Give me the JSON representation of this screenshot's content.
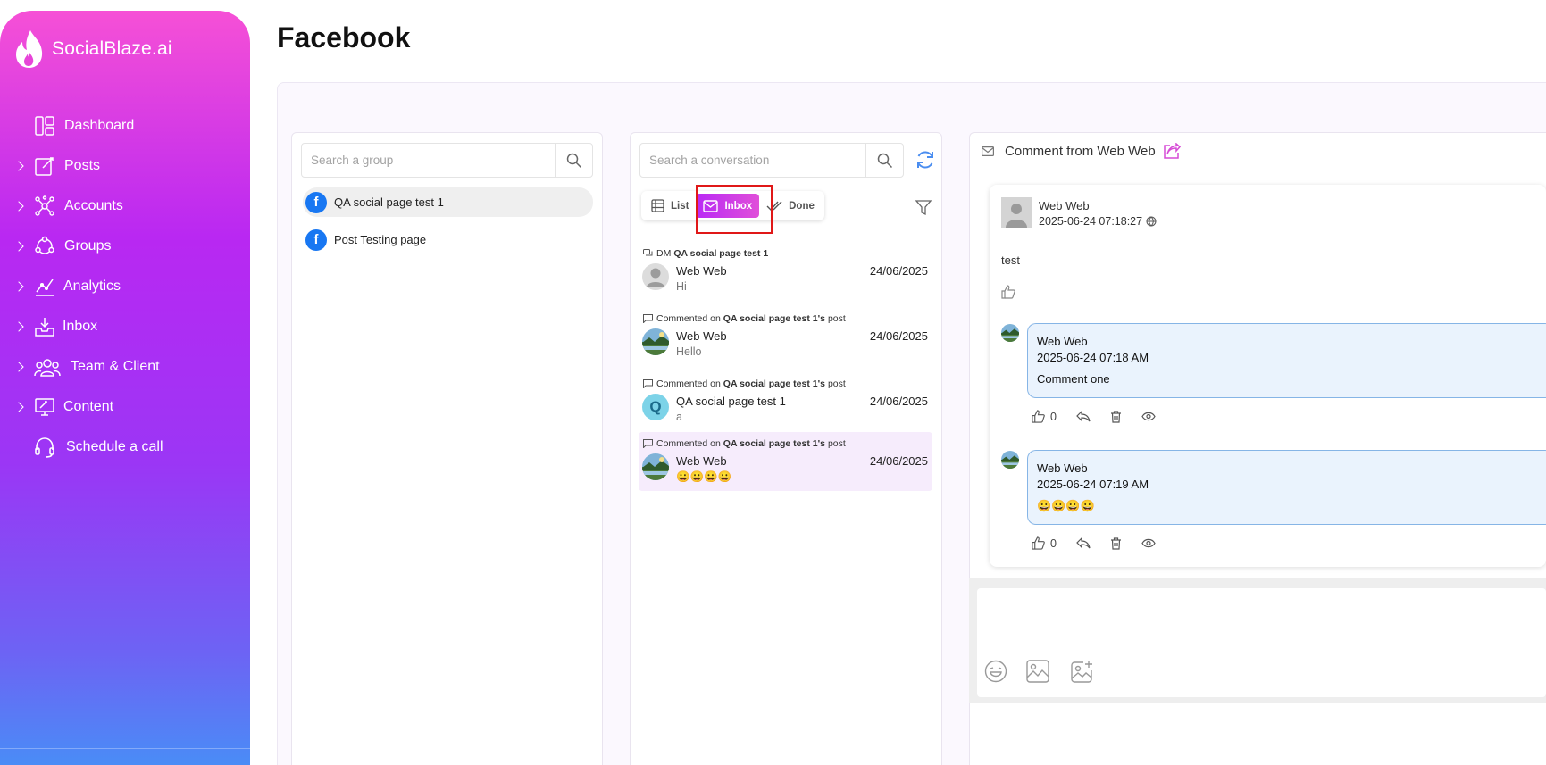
{
  "brand": {
    "name": "SocialBlaze.ai"
  },
  "sidebar": {
    "items": [
      {
        "label": "Dashboard",
        "icon": "dashboard-icon",
        "expandable": false
      },
      {
        "label": "Posts",
        "icon": "posts-icon",
        "expandable": true
      },
      {
        "label": "Accounts",
        "icon": "accounts-icon",
        "expandable": true
      },
      {
        "label": "Groups",
        "icon": "groups-icon",
        "expandable": true
      },
      {
        "label": "Analytics",
        "icon": "analytics-icon",
        "expandable": true
      },
      {
        "label": "Inbox",
        "icon": "inbox-icon",
        "expandable": true
      },
      {
        "label": "Team & Client",
        "icon": "team-icon",
        "expandable": true
      },
      {
        "label": "Content",
        "icon": "content-icon",
        "expandable": true
      },
      {
        "label": "Schedule a call",
        "icon": "headset-icon",
        "expandable": false
      }
    ]
  },
  "page": {
    "title": "Facebook"
  },
  "groups": {
    "search_placeholder": "Search a group",
    "items": [
      {
        "name": "QA social page test 1",
        "active": true
      },
      {
        "name": "Post Testing page",
        "active": false
      }
    ]
  },
  "conversations": {
    "search_placeholder": "Search a conversation",
    "tabs": [
      {
        "label": "List",
        "active": false
      },
      {
        "label": "Inbox",
        "active": true
      },
      {
        "label": "Done",
        "active": false
      }
    ],
    "items": [
      {
        "type_prefix": "DM",
        "page": "QA social page test 1",
        "suffix": "",
        "name": "Web Web",
        "snippet": "Hi",
        "date": "24/06/2025",
        "avatar": "default",
        "active": false
      },
      {
        "type_prefix": "Commented on",
        "page": "QA social page test 1's",
        "suffix": "post",
        "name": "Web Web",
        "snippet": "Hello",
        "date": "24/06/2025",
        "avatar": "landscape",
        "active": false
      },
      {
        "type_prefix": "Commented on",
        "page": "QA social page test 1's",
        "suffix": "post",
        "name": "QA social page test 1",
        "snippet": "a",
        "date": "24/06/2025",
        "avatar": "Q",
        "active": false
      },
      {
        "type_prefix": "Commented on",
        "page": "QA social page test 1's",
        "suffix": "post",
        "name": "Web Web",
        "snippet": "😀😀😀😀",
        "date": "24/06/2025",
        "avatar": "landscape",
        "active": true
      }
    ]
  },
  "detail": {
    "title": "Comment from Web Web",
    "post": {
      "author": "Web Web",
      "timestamp": "2025-06-24 07:18:27",
      "text": "test"
    },
    "comments": [
      {
        "author": "Web Web",
        "timestamp": "2025-06-24 07:18 AM",
        "text": "Comment one",
        "likes": "0"
      },
      {
        "author": "Web Web",
        "timestamp": "2025-06-24 07:19 AM",
        "text": "😀😀😀😀",
        "likes": "0"
      }
    ]
  },
  "colors": {
    "accent": "#b929f5",
    "accent_pink": "#e04fd9",
    "facebook": "#1877f2",
    "highlight": "#e01818"
  }
}
